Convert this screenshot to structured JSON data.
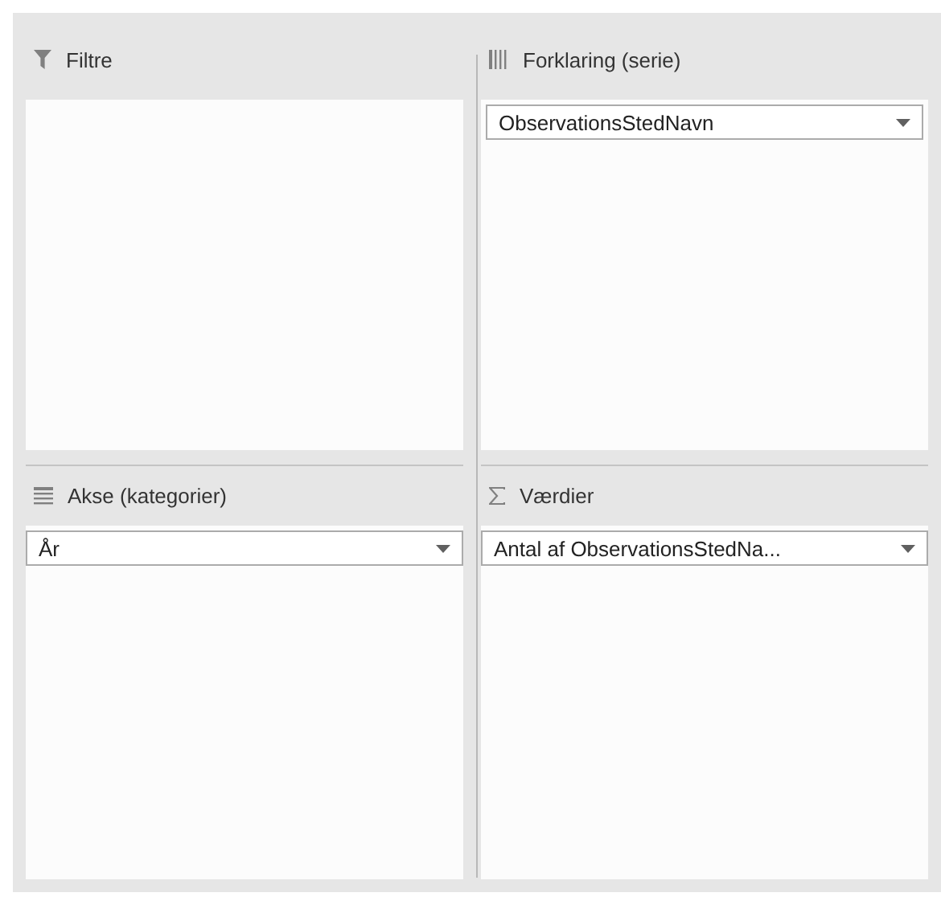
{
  "areas": [
    {
      "kind": "filter",
      "label": "Filtre"
    },
    {
      "kind": "columns",
      "label": "Forklaring (serie)",
      "fields": [
        {
          "label": "ObservationsStedNavn"
        }
      ]
    },
    {
      "kind": "rows",
      "label": "Akse (kategorier)",
      "fields": [
        {
          "label": "År"
        }
      ]
    },
    {
      "kind": "values",
      "label": "Værdier",
      "fields": [
        {
          "label": "Antal af ObservationsStedNa..."
        }
      ]
    }
  ]
}
